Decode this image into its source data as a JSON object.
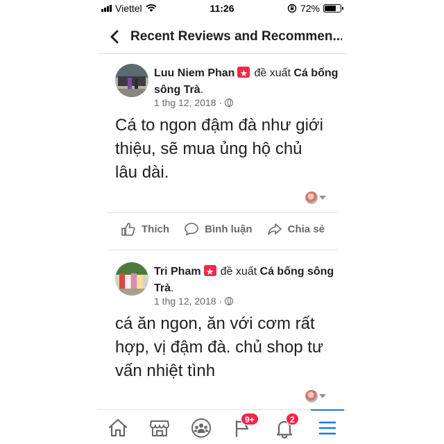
{
  "status_bar": {
    "carrier": "Viettel",
    "time": "11:26",
    "battery_percent": "72%",
    "battery_level": 0.72
  },
  "header": {
    "title": "Recent Reviews and Recommen..."
  },
  "posts": [
    {
      "author": "Luu Niem Phan",
      "verb": "đề xuất",
      "page": "Cá bống sông Trà",
      "date": "1 thg 12, 2018",
      "separator": "·",
      "text": "Cá to ngon đậm đà như giới thiệu, sẽ mua ủng hộ chủ lâu dài."
    },
    {
      "author": "Tri Pham",
      "verb": "đề xuất",
      "page": "Cá bống sông Trà",
      "date": "1 thg 12, 2018",
      "separator": "·",
      "text": "cá ăn ngon, ăn với cơm rất hợp, vị đậm đà. chủ shop tư vấn nhiệt tình"
    }
  ],
  "actions": {
    "like": "Thích",
    "comment": "Bình luận",
    "share": "Chia sẻ"
  },
  "tabbar": {
    "notifications_badge": "9+",
    "messages_badge": "2"
  },
  "icons": {
    "back": "chevron-left-icon",
    "home": "home-icon",
    "marketplace": "store-icon",
    "groups": "groups-icon",
    "notifications": "flag-icon",
    "bell": "bell-icon",
    "menu": "menu-icon"
  },
  "colors": {
    "accent": "#1877f2",
    "badge": "#f02849",
    "muted": "#65676b"
  }
}
